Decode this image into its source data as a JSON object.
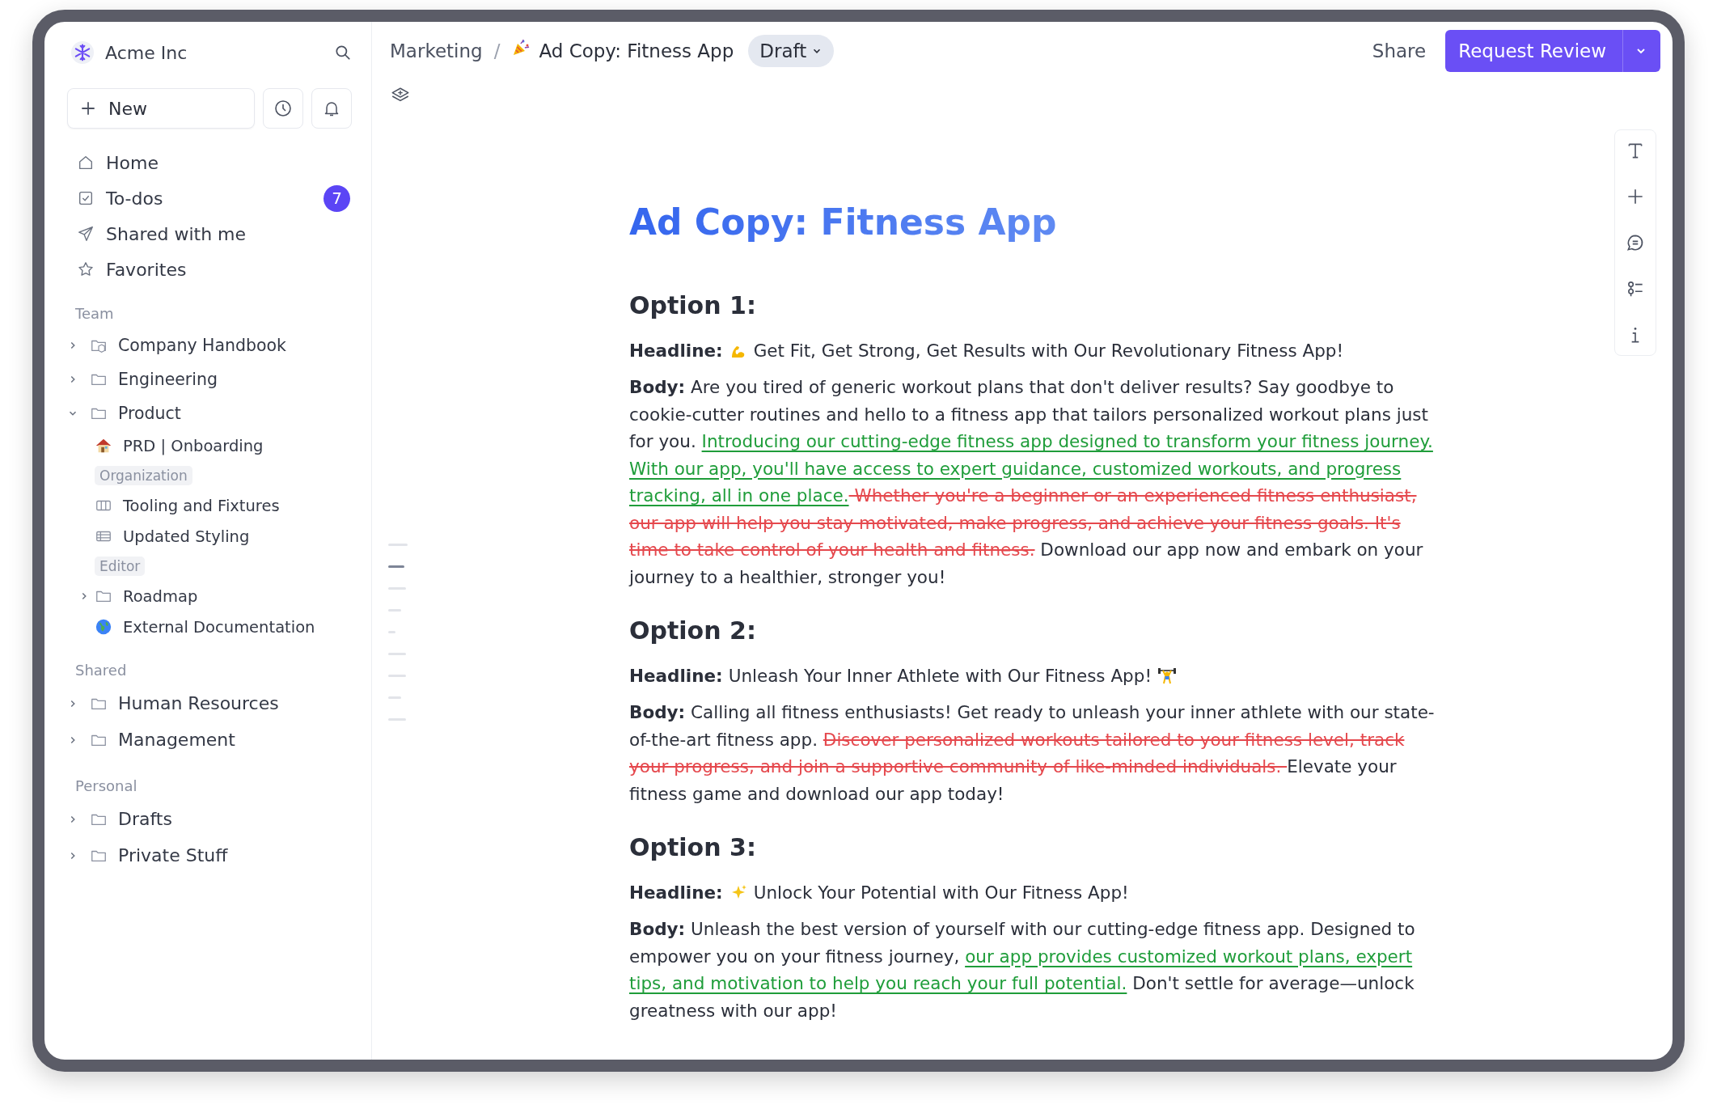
{
  "workspace": {
    "name": "Acme Inc"
  },
  "new_button": {
    "label": "New"
  },
  "nav": [
    {
      "kind": "home",
      "label": "Home",
      "selected": false
    },
    {
      "kind": "todo",
      "label": "To-dos",
      "badge": "7",
      "selected": false
    },
    {
      "kind": "send",
      "label": "Shared with me",
      "selected": false
    },
    {
      "kind": "star",
      "label": "Favorites",
      "selected": false
    }
  ],
  "sections": [
    {
      "title": "Team",
      "items": [
        {
          "kind": "handbook",
          "label": "Company Handbook",
          "expanded": false
        },
        {
          "kind": "folder",
          "label": "Engineering",
          "expanded": false
        },
        {
          "kind": "folder",
          "label": "Product",
          "expanded": true,
          "children": [
            {
              "kind": "house",
              "label": "PRD | Onboarding"
            },
            {
              "kind": "tag",
              "label": "Organization"
            },
            {
              "kind": "board",
              "label": "Tooling and Fixtures"
            },
            {
              "kind": "table",
              "label": "Updated Styling"
            },
            {
              "kind": "tag",
              "label": "Editor"
            },
            {
              "kind": "folder",
              "label": "Roadmap",
              "expanded": false
            },
            {
              "kind": "globe",
              "label": "External Documentation"
            }
          ]
        }
      ]
    },
    {
      "title": "Shared",
      "items": [
        {
          "kind": "folder",
          "label": "Human Resources",
          "expanded": false
        },
        {
          "kind": "folder",
          "label": "Management",
          "expanded": false
        }
      ]
    },
    {
      "title": "Personal",
      "items": [
        {
          "kind": "folder",
          "label": "Drafts",
          "expanded": false
        },
        {
          "kind": "folder",
          "label": "Private Stuff",
          "expanded": false
        }
      ]
    }
  ],
  "breadcrumb": {
    "parent": "Marketing",
    "separator": "/",
    "page": "Ad Copy: Fitness App",
    "status": "Draft"
  },
  "header_actions": {
    "share": "Share",
    "primary": "Request Review"
  },
  "outline_marks": [
    {
      "selected": false
    },
    {
      "selected": true
    },
    {
      "selected": false
    },
    {
      "selected": false
    },
    {
      "selected": false
    },
    {
      "selected": false
    },
    {
      "selected": false
    },
    {
      "selected": false
    },
    {
      "selected": false
    }
  ],
  "document": {
    "title": "Ad Copy: Fitness App",
    "options": [
      {
        "heading": "Option 1:",
        "headline": {
          "label": "Headline:",
          "parts": [
            {
              "kind": "arm"
            },
            {
              "kind": "text",
              "text": "Get Fit, Get Strong, Get Results with Our Revolutionary Fitness App!"
            }
          ]
        },
        "body": {
          "label": "Body:",
          "segments": [
            {
              "kind": "plain",
              "text": "Are you tired of generic workout plans that don't deliver results? Say goodbye to cookie-cutter routines and hello to a fitness app that tailors personalized workout plans just for you. "
            },
            {
              "kind": "inserted",
              "text": "Introducing our cutting-edge fitness app designed to transform your fitness journey. With our app, you'll have access to expert guidance, customized workouts, and progress tracking, all in one place."
            },
            {
              "kind": "deleted",
              "text": " Whether you're a beginner or an experienced fitness enthusiast, our app will help you stay motivated, make progress, and achieve your fitness goals. It's time to take control of your health and fitness."
            },
            {
              "kind": "plain",
              "text": " Download our app now and embark on your journey to a healthier, stronger you!"
            }
          ]
        }
      },
      {
        "heading": "Option 2:",
        "headline": {
          "label": "Headline:",
          "parts": [
            {
              "kind": "text",
              "text": "Unleash Your Inner Athlete with Our Fitness App!"
            },
            {
              "kind": "lifter"
            }
          ]
        },
        "body": {
          "label": "Body:",
          "segments": [
            {
              "kind": "plain",
              "text": "Calling all fitness enthusiasts! Get ready to unleash your inner athlete with our state-of-the-art fitness app. "
            },
            {
              "kind": "deleted",
              "text": "Discover personalized workouts tailored to your fitness level, track your progress, and join a supportive community of like-minded individuals. "
            },
            {
              "kind": "plain",
              "text": "Elevate your fitness game and download our app today!"
            }
          ]
        }
      },
      {
        "heading": "Option 3:",
        "headline": {
          "label": "Headline:",
          "parts": [
            {
              "kind": "sparkle"
            },
            {
              "kind": "text",
              "text": "Unlock Your Potential with Our Fitness App!"
            }
          ]
        },
        "body": {
          "label": "Body:",
          "segments": [
            {
              "kind": "plain",
              "text": "Unleash the best version of yourself with our cutting-edge fitness app. Designed to empower you on your fitness journey, "
            },
            {
              "kind": "inserted",
              "text": "our app provides customized workout plans, expert tips, and motivation to help you reach your full potential."
            },
            {
              "kind": "plain",
              "text": " Don't settle for average—unlock greatness with our app!"
            }
          ]
        }
      }
    ]
  }
}
